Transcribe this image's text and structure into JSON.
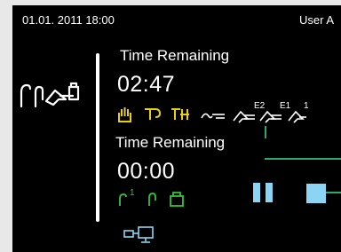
{
  "status_bar": {
    "datetime": "01.01. 2011 18:00",
    "user": "User A"
  },
  "upper_timer": {
    "label": "Time Remaining",
    "value": "02:47"
  },
  "lower_timer": {
    "label": "Time Remaining",
    "value": "00:00"
  },
  "tools": {
    "e2_label": "E2",
    "e1_label": "E1",
    "one_label": "1"
  },
  "lower_icons": {
    "one_label": "1"
  },
  "colors": {
    "background": "#000000",
    "yellow": "#e8d10a",
    "green": "#34c43a",
    "flow_line": "#2aaa6e",
    "control": "#8cd4f4"
  },
  "icons": {
    "left": "handpiece-set-icon",
    "row_upper": [
      "hand-icon",
      "bur-icon",
      "double-bur-icon",
      "scaler-icon",
      "instrument-e2-icon",
      "instrument-e1-icon",
      "instrument-1-icon"
    ],
    "row_lower": [
      "motor-1-icon",
      "motor-icon",
      "container-icon"
    ],
    "controls": [
      "pause-icon",
      "stop-icon"
    ],
    "bottom": "network-icon"
  }
}
